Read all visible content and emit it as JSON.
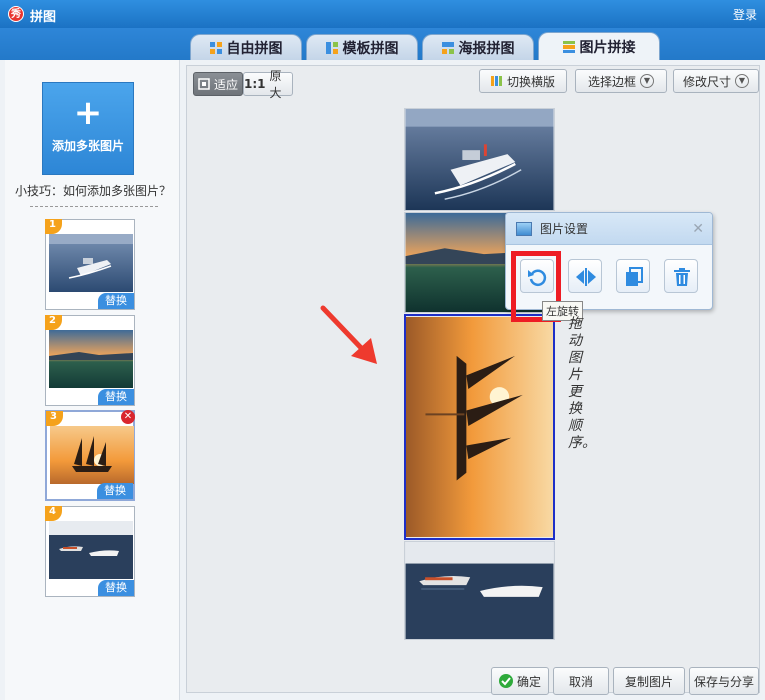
{
  "window": {
    "title": "拼图",
    "login": "登录"
  },
  "tabs": [
    {
      "label": "自由拼图",
      "icon": "free-collage-icon"
    },
    {
      "label": "模板拼图",
      "icon": "template-collage-icon"
    },
    {
      "label": "海报拼图",
      "icon": "poster-collage-icon"
    },
    {
      "label": "图片拼接",
      "icon": "image-join-icon",
      "active": true
    }
  ],
  "sidebar": {
    "add_label": "添加多张图片",
    "tip": "小技巧：如何添加多张图片？",
    "thumbnails": [
      {
        "num": "1",
        "scene": "cargo ship at sea",
        "replace": "替换"
      },
      {
        "num": "2",
        "scene": "lake at sunset",
        "replace": "替换"
      },
      {
        "num": "3",
        "scene": "sailing ship at sunset",
        "replace": "替换",
        "selected": true
      },
      {
        "num": "4",
        "scene": "boats on water",
        "replace": "替换"
      }
    ]
  },
  "toolbar": {
    "fit": "适应",
    "original_prefix": "1:1",
    "original": "原大",
    "switch_layout": "切换横版",
    "choose_border": "选择边框",
    "resize": "修改尺寸"
  },
  "popup": {
    "title": "图片设置",
    "tooltip": "左旋转",
    "buttons": [
      "rotate-left-icon",
      "flip-horizontal-icon",
      "copy-icon",
      "trash-icon"
    ]
  },
  "hint_text": "拖动图片更换顺序。",
  "footer": {
    "confirm": "确定",
    "cancel": "取消",
    "copy": "复制图片",
    "save_share": "保存与分享"
  },
  "colors": {
    "titlebar": "#2f8fe0",
    "accent": "#3b8fe0",
    "highlight": "#ee1c24",
    "selection": "#1e2fc7"
  }
}
